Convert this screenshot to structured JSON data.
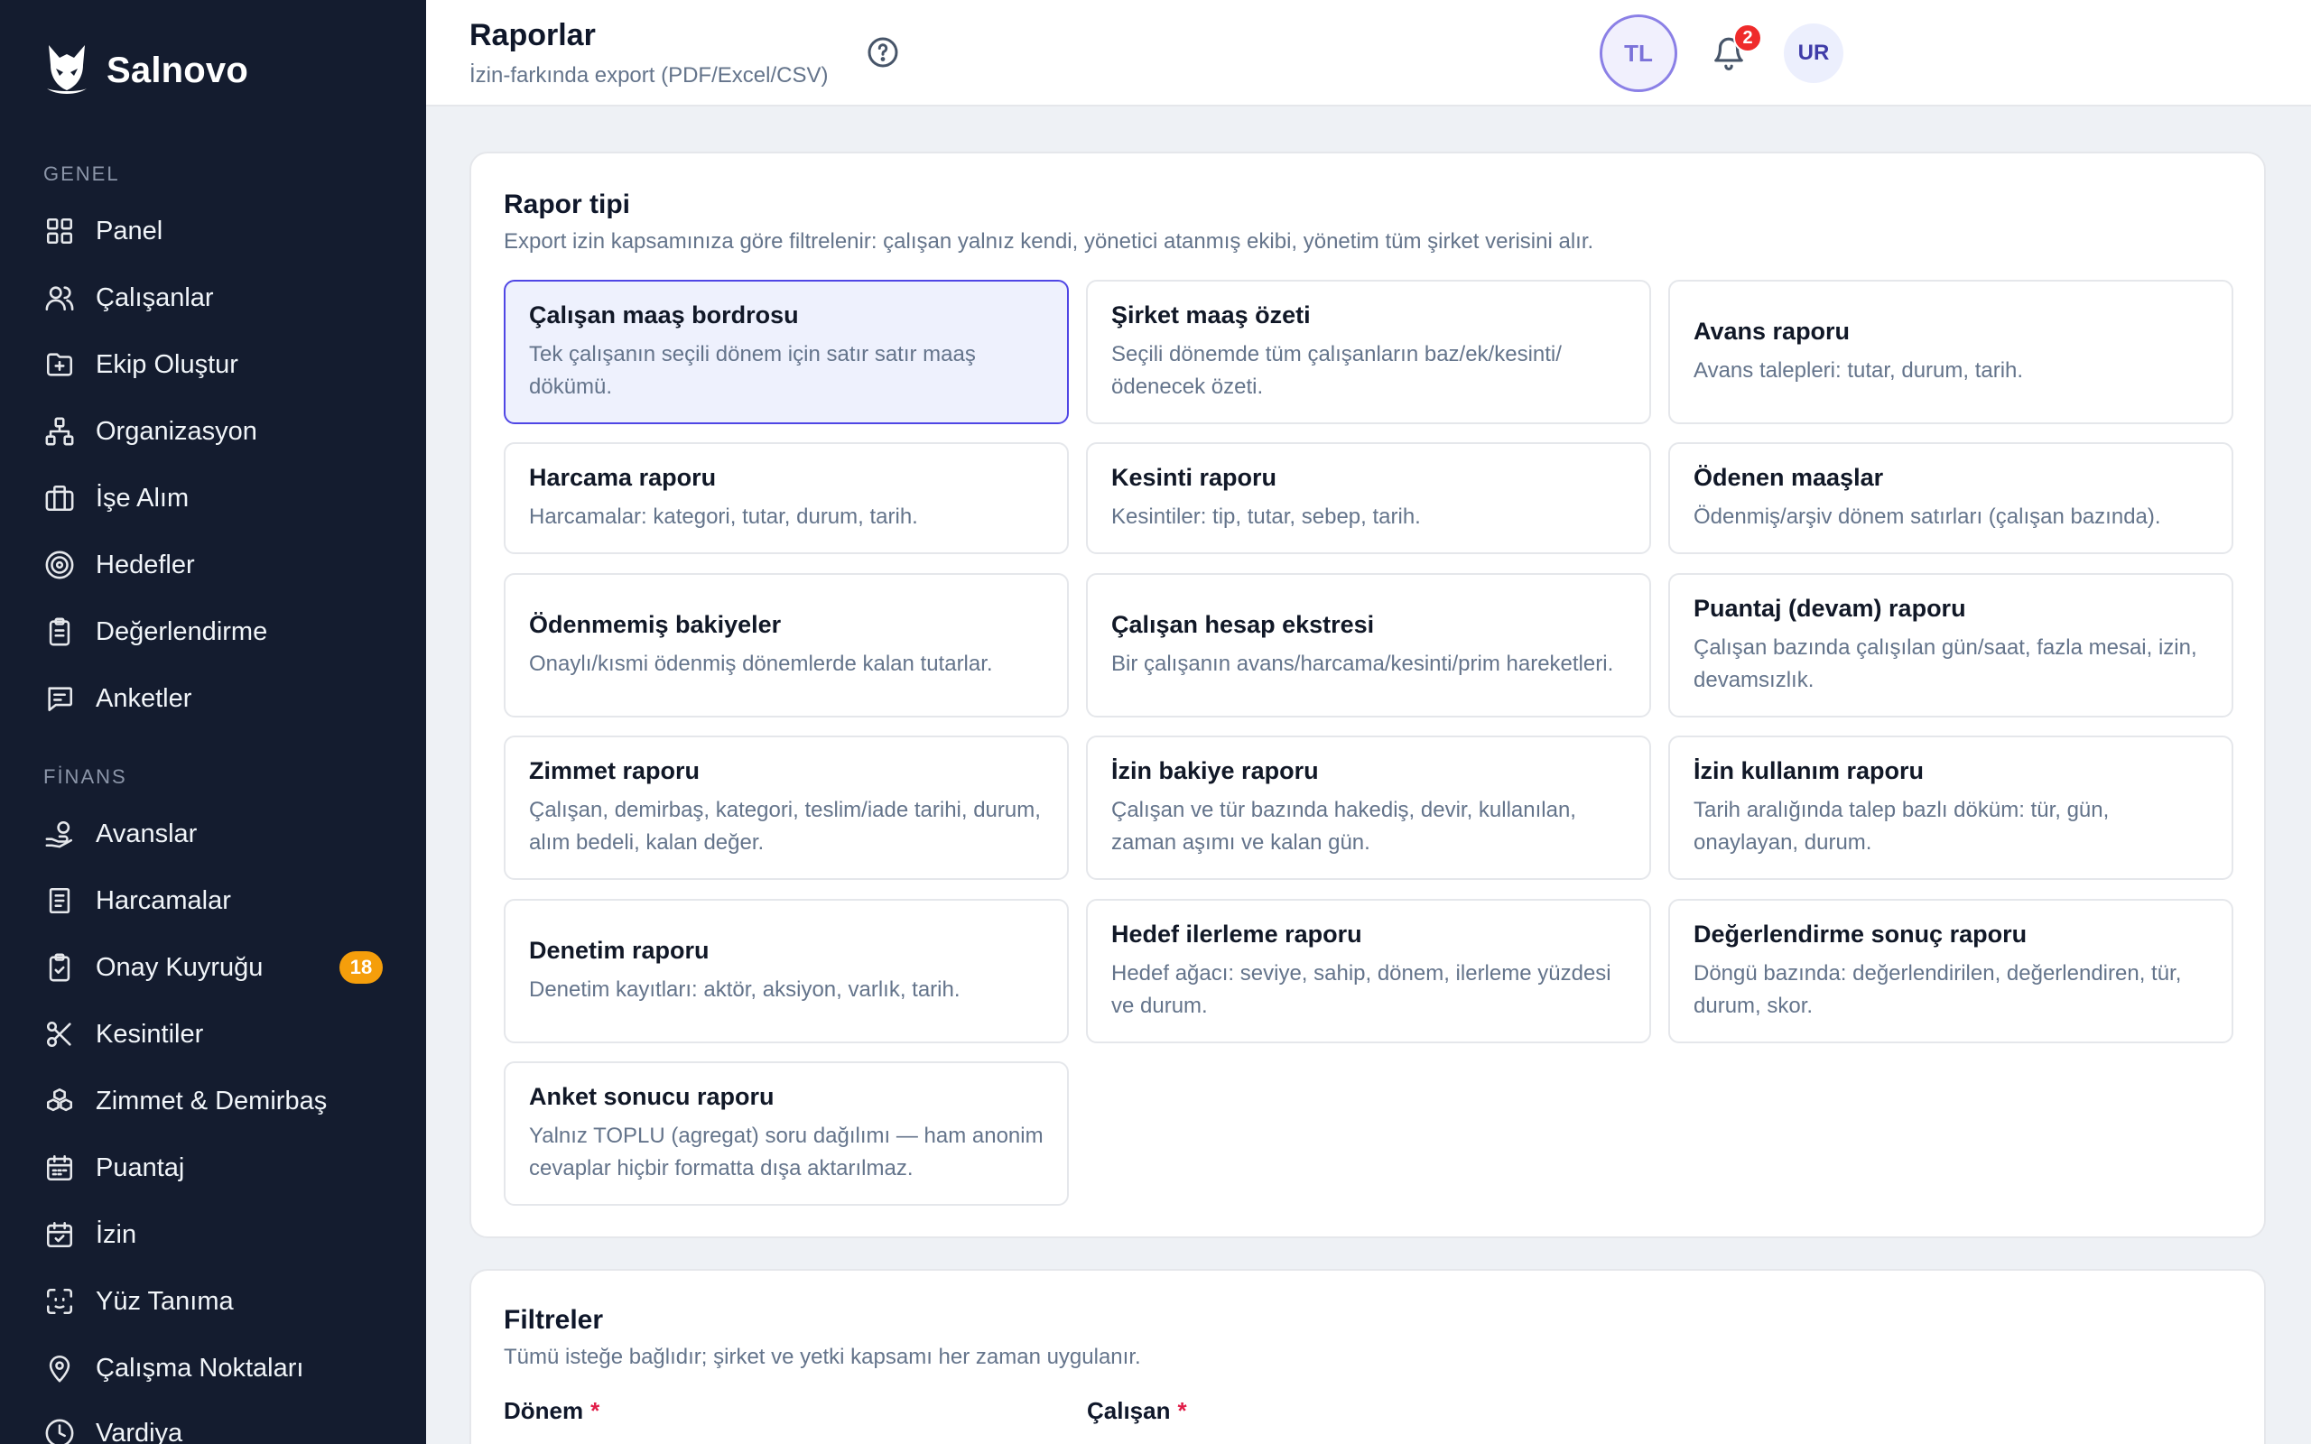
{
  "brand": {
    "name": "Salnovo"
  },
  "sidebar": {
    "sections": [
      {
        "label": "GENEL"
      },
      {
        "label": "FİNANS"
      }
    ],
    "general_items": [
      {
        "label": "Panel",
        "icon": "grid-icon"
      },
      {
        "label": "Çalışanlar",
        "icon": "users-icon"
      },
      {
        "label": "Ekip Oluştur",
        "icon": "folder-plus-icon"
      },
      {
        "label": "Organizasyon",
        "icon": "org-chart-icon"
      },
      {
        "label": "İşe Alım",
        "icon": "briefcase-icon"
      },
      {
        "label": "Hedefler",
        "icon": "target-icon"
      },
      {
        "label": "Değerlendirme",
        "icon": "clipboard-icon"
      },
      {
        "label": "Anketler",
        "icon": "message-icon"
      }
    ],
    "finance_items": [
      {
        "label": "Avanslar",
        "icon": "hand-coins-icon"
      },
      {
        "label": "Harcamalar",
        "icon": "receipt-icon"
      },
      {
        "label": "Onay Kuyruğu",
        "icon": "clipboard-check-icon",
        "badge": "18"
      },
      {
        "label": "Kesintiler",
        "icon": "scissors-icon"
      },
      {
        "label": "Zimmet & Demirbaş",
        "icon": "boxes-icon"
      },
      {
        "label": "Puantaj",
        "icon": "calendar-icon"
      },
      {
        "label": "İzin",
        "icon": "calendar-check-icon"
      },
      {
        "label": "Yüz Tanıma",
        "icon": "face-scan-icon"
      },
      {
        "label": "Çalışma Noktaları",
        "icon": "map-pin-icon"
      },
      {
        "label": "Vardiya",
        "icon": "clock-icon"
      }
    ]
  },
  "header": {
    "title": "Raporlar",
    "subtitle": "İzin-farkında export (PDF/Excel/CSV)",
    "avatar_tl": "TL",
    "notification_count": "2",
    "avatar_ur": "UR"
  },
  "report_type": {
    "title": "Rapor tipi",
    "description": "Export izin kapsamınıza göre filtrelenir: çalışan yalnız kendi, yönetici atanmış ekibi, yönetim tüm şirket verisini alır.",
    "selected_index": 0,
    "cards": [
      {
        "title": "Çalışan maaş bordrosu",
        "desc": "Tek çalışanın seçili dönem için satır satır maaş dökümü."
      },
      {
        "title": "Şirket maaş özeti",
        "desc": "Seçili dönemde tüm çalışanların baz/ek/kesinti/ ödenecek özeti."
      },
      {
        "title": "Avans raporu",
        "desc": "Avans talepleri: tutar, durum, tarih."
      },
      {
        "title": "Harcama raporu",
        "desc": "Harcamalar: kategori, tutar, durum, tarih."
      },
      {
        "title": "Kesinti raporu",
        "desc": "Kesintiler: tip, tutar, sebep, tarih."
      },
      {
        "title": "Ödenen maaşlar",
        "desc": "Ödenmiş/arşiv dönem satırları (çalışan bazında)."
      },
      {
        "title": "Ödenmemiş bakiyeler",
        "desc": "Onaylı/kısmi ödenmiş dönemlerde kalan tutarlar."
      },
      {
        "title": "Çalışan hesap ekstresi",
        "desc": "Bir çalışanın avans/harcama/kesinti/prim hareketleri."
      },
      {
        "title": "Puantaj (devam) raporu",
        "desc": "Çalışan bazında çalışılan gün/saat, fazla mesai, izin, devamsızlık."
      },
      {
        "title": "Zimmet raporu",
        "desc": "Çalışan, demirbaş, kategori, teslim/iade tarihi, durum, alım bedeli, kalan değer."
      },
      {
        "title": "İzin bakiye raporu",
        "desc": "Çalışan ve tür bazında hakediş, devir, kullanılan, zaman aşımı ve kalan gün."
      },
      {
        "title": "İzin kullanım raporu",
        "desc": "Tarih aralığında talep bazlı döküm: tür, gün, onaylayan, durum."
      },
      {
        "title": "Denetim raporu",
        "desc": "Denetim kayıtları: aktör, aksiyon, varlık, tarih."
      },
      {
        "title": "Hedef ilerleme raporu",
        "desc": "Hedef ağacı: seviye, sahip, dönem, ilerleme yüzdesi ve durum."
      },
      {
        "title": "Değerlendirme sonuç raporu",
        "desc": "Döngü bazında: değerlendirilen, değerlendiren, tür, durum, skor."
      },
      {
        "title": "Anket sonucu raporu",
        "desc": "Yalnız TOPLU (agregat) soru dağılımı — ham anonim cevaplar hiçbir formatta dışa aktarılmaz."
      }
    ]
  },
  "filters": {
    "title": "Filtreler",
    "description": "Tümü isteğe bağlıdır; şirket ve yetki kapsamı her zaman uygulanır.",
    "period_label": "Dönem",
    "employee_label": "Çalışan",
    "required_mark": "*"
  }
}
